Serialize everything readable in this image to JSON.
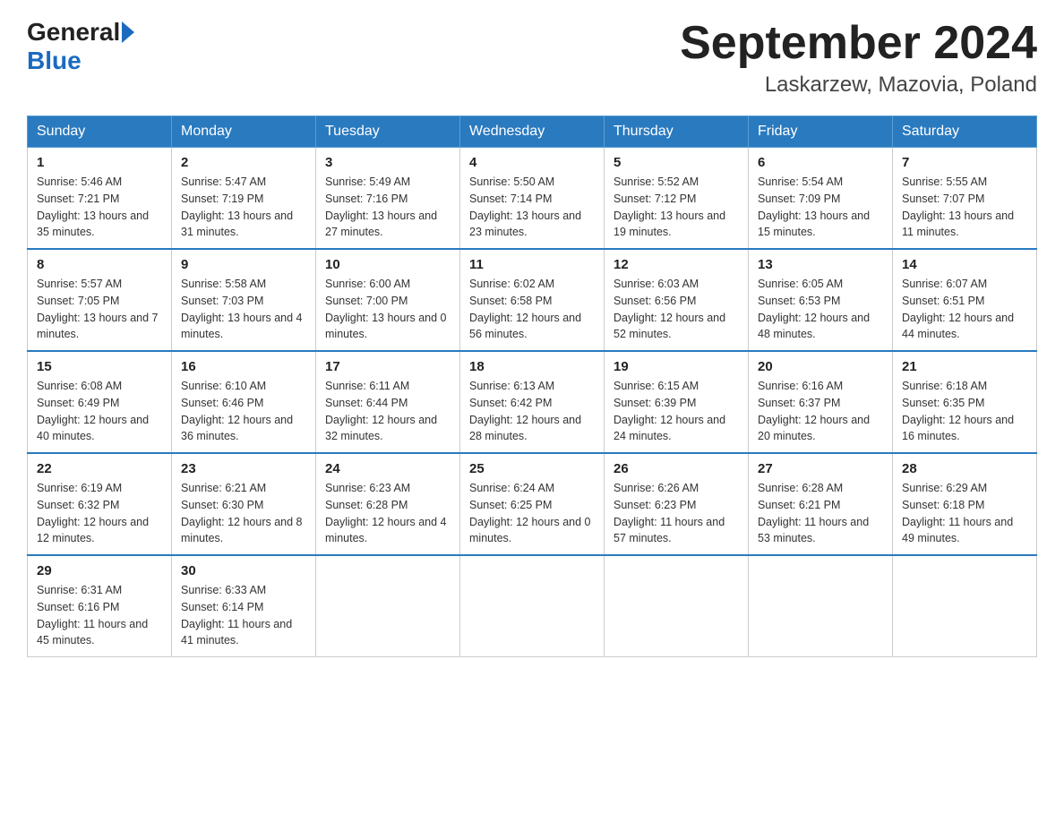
{
  "header": {
    "logo_general": "General",
    "logo_blue": "Blue",
    "month_title": "September 2024",
    "location": "Laskarzew, Mazovia, Poland"
  },
  "days_of_week": [
    "Sunday",
    "Monday",
    "Tuesday",
    "Wednesday",
    "Thursday",
    "Friday",
    "Saturday"
  ],
  "weeks": [
    [
      {
        "day": "1",
        "sunrise": "Sunrise: 5:46 AM",
        "sunset": "Sunset: 7:21 PM",
        "daylight": "Daylight: 13 hours and 35 minutes."
      },
      {
        "day": "2",
        "sunrise": "Sunrise: 5:47 AM",
        "sunset": "Sunset: 7:19 PM",
        "daylight": "Daylight: 13 hours and 31 minutes."
      },
      {
        "day": "3",
        "sunrise": "Sunrise: 5:49 AM",
        "sunset": "Sunset: 7:16 PM",
        "daylight": "Daylight: 13 hours and 27 minutes."
      },
      {
        "day": "4",
        "sunrise": "Sunrise: 5:50 AM",
        "sunset": "Sunset: 7:14 PM",
        "daylight": "Daylight: 13 hours and 23 minutes."
      },
      {
        "day": "5",
        "sunrise": "Sunrise: 5:52 AM",
        "sunset": "Sunset: 7:12 PM",
        "daylight": "Daylight: 13 hours and 19 minutes."
      },
      {
        "day": "6",
        "sunrise": "Sunrise: 5:54 AM",
        "sunset": "Sunset: 7:09 PM",
        "daylight": "Daylight: 13 hours and 15 minutes."
      },
      {
        "day": "7",
        "sunrise": "Sunrise: 5:55 AM",
        "sunset": "Sunset: 7:07 PM",
        "daylight": "Daylight: 13 hours and 11 minutes."
      }
    ],
    [
      {
        "day": "8",
        "sunrise": "Sunrise: 5:57 AM",
        "sunset": "Sunset: 7:05 PM",
        "daylight": "Daylight: 13 hours and 7 minutes."
      },
      {
        "day": "9",
        "sunrise": "Sunrise: 5:58 AM",
        "sunset": "Sunset: 7:03 PM",
        "daylight": "Daylight: 13 hours and 4 minutes."
      },
      {
        "day": "10",
        "sunrise": "Sunrise: 6:00 AM",
        "sunset": "Sunset: 7:00 PM",
        "daylight": "Daylight: 13 hours and 0 minutes."
      },
      {
        "day": "11",
        "sunrise": "Sunrise: 6:02 AM",
        "sunset": "Sunset: 6:58 PM",
        "daylight": "Daylight: 12 hours and 56 minutes."
      },
      {
        "day": "12",
        "sunrise": "Sunrise: 6:03 AM",
        "sunset": "Sunset: 6:56 PM",
        "daylight": "Daylight: 12 hours and 52 minutes."
      },
      {
        "day": "13",
        "sunrise": "Sunrise: 6:05 AM",
        "sunset": "Sunset: 6:53 PM",
        "daylight": "Daylight: 12 hours and 48 minutes."
      },
      {
        "day": "14",
        "sunrise": "Sunrise: 6:07 AM",
        "sunset": "Sunset: 6:51 PM",
        "daylight": "Daylight: 12 hours and 44 minutes."
      }
    ],
    [
      {
        "day": "15",
        "sunrise": "Sunrise: 6:08 AM",
        "sunset": "Sunset: 6:49 PM",
        "daylight": "Daylight: 12 hours and 40 minutes."
      },
      {
        "day": "16",
        "sunrise": "Sunrise: 6:10 AM",
        "sunset": "Sunset: 6:46 PM",
        "daylight": "Daylight: 12 hours and 36 minutes."
      },
      {
        "day": "17",
        "sunrise": "Sunrise: 6:11 AM",
        "sunset": "Sunset: 6:44 PM",
        "daylight": "Daylight: 12 hours and 32 minutes."
      },
      {
        "day": "18",
        "sunrise": "Sunrise: 6:13 AM",
        "sunset": "Sunset: 6:42 PM",
        "daylight": "Daylight: 12 hours and 28 minutes."
      },
      {
        "day": "19",
        "sunrise": "Sunrise: 6:15 AM",
        "sunset": "Sunset: 6:39 PM",
        "daylight": "Daylight: 12 hours and 24 minutes."
      },
      {
        "day": "20",
        "sunrise": "Sunrise: 6:16 AM",
        "sunset": "Sunset: 6:37 PM",
        "daylight": "Daylight: 12 hours and 20 minutes."
      },
      {
        "day": "21",
        "sunrise": "Sunrise: 6:18 AM",
        "sunset": "Sunset: 6:35 PM",
        "daylight": "Daylight: 12 hours and 16 minutes."
      }
    ],
    [
      {
        "day": "22",
        "sunrise": "Sunrise: 6:19 AM",
        "sunset": "Sunset: 6:32 PM",
        "daylight": "Daylight: 12 hours and 12 minutes."
      },
      {
        "day": "23",
        "sunrise": "Sunrise: 6:21 AM",
        "sunset": "Sunset: 6:30 PM",
        "daylight": "Daylight: 12 hours and 8 minutes."
      },
      {
        "day": "24",
        "sunrise": "Sunrise: 6:23 AM",
        "sunset": "Sunset: 6:28 PM",
        "daylight": "Daylight: 12 hours and 4 minutes."
      },
      {
        "day": "25",
        "sunrise": "Sunrise: 6:24 AM",
        "sunset": "Sunset: 6:25 PM",
        "daylight": "Daylight: 12 hours and 0 minutes."
      },
      {
        "day": "26",
        "sunrise": "Sunrise: 6:26 AM",
        "sunset": "Sunset: 6:23 PM",
        "daylight": "Daylight: 11 hours and 57 minutes."
      },
      {
        "day": "27",
        "sunrise": "Sunrise: 6:28 AM",
        "sunset": "Sunset: 6:21 PM",
        "daylight": "Daylight: 11 hours and 53 minutes."
      },
      {
        "day": "28",
        "sunrise": "Sunrise: 6:29 AM",
        "sunset": "Sunset: 6:18 PM",
        "daylight": "Daylight: 11 hours and 49 minutes."
      }
    ],
    [
      {
        "day": "29",
        "sunrise": "Sunrise: 6:31 AM",
        "sunset": "Sunset: 6:16 PM",
        "daylight": "Daylight: 11 hours and 45 minutes."
      },
      {
        "day": "30",
        "sunrise": "Sunrise: 6:33 AM",
        "sunset": "Sunset: 6:14 PM",
        "daylight": "Daylight: 11 hours and 41 minutes."
      },
      null,
      null,
      null,
      null,
      null
    ]
  ]
}
